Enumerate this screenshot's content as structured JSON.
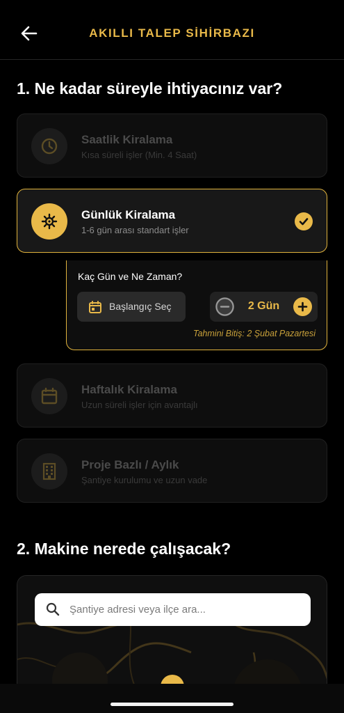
{
  "header": {
    "title": "AKILLI TALEP SİHİRBAZI",
    "back_icon": "arrow-left-icon"
  },
  "colors": {
    "accent": "#e9b949",
    "background": "#000000",
    "card": "#0e0e0e"
  },
  "section1": {
    "title": "1. Ne kadar süreyle ihtiyacınız var?",
    "options": [
      {
        "title": "Saatlik Kiralama",
        "subtitle": "Kısa süreli işler (Min. 4 Saat)",
        "icon": "clock-icon",
        "selected": false
      },
      {
        "title": "Günlük Kiralama",
        "subtitle": "1-6 gün arası standart işler",
        "icon": "sun-icon",
        "selected": true
      },
      {
        "title": "Haftalık Kiralama",
        "subtitle": "Uzun süreli işler için avantajlı",
        "icon": "calendar-icon",
        "selected": false
      },
      {
        "title": "Proje Bazlı / Aylık",
        "subtitle": "Şantiye kurulumu ve uzun vade",
        "icon": "building-icon",
        "selected": false
      }
    ],
    "day_panel": {
      "question": "Kaç Gün ve Ne Zaman?",
      "start_button": "Başlangıç Seç",
      "day_count": "2 Gün",
      "estimate": "Tahmini Bitiş: 2 Şubat Pazartesi"
    }
  },
  "section2": {
    "title": "2. Makine nerede çalışacak?",
    "search": {
      "placeholder": "Şantiye adresi veya ilçe ara...",
      "value": ""
    }
  }
}
